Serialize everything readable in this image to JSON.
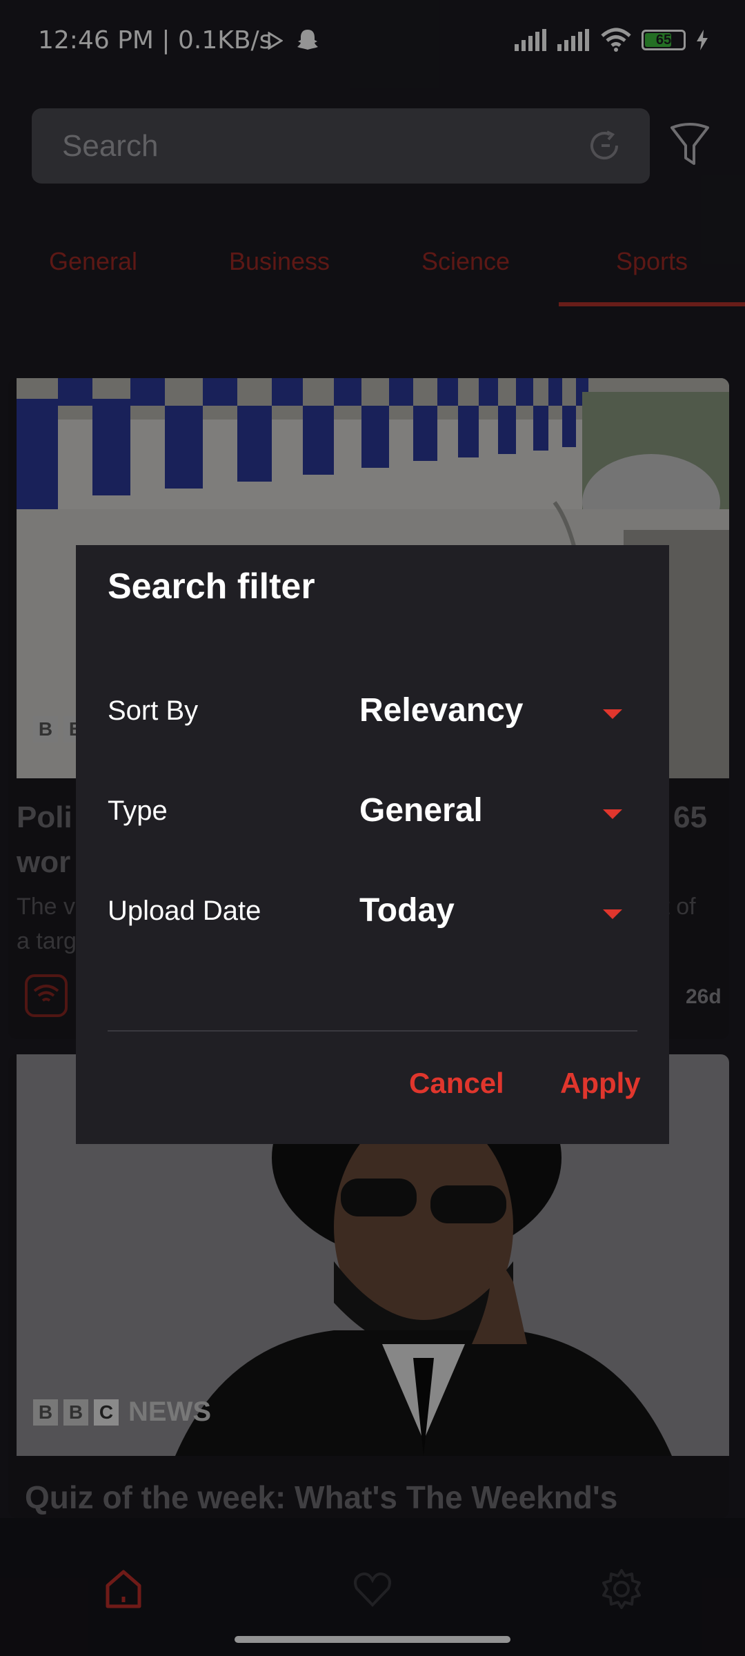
{
  "status": {
    "time": "12:46 PM | 0.1KB/s",
    "battery": "65"
  },
  "search": {
    "placeholder": "Search"
  },
  "tabs": [
    {
      "label": "General"
    },
    {
      "label": "Business"
    },
    {
      "label": "Science"
    },
    {
      "label": "Sports"
    }
  ],
  "cards": [
    {
      "title_start": "Poli",
      "title_end": "65",
      "title_line2": "wor",
      "desc_start": "The v",
      "desc_end": "rt of",
      "desc_line2": "a targ",
      "age": "26d"
    },
    {
      "title": "Quiz of the week: What's The Weeknd's",
      "logo_text": "NEWS"
    }
  ],
  "dialog": {
    "title": "Search filter",
    "rows": [
      {
        "label": "Sort By",
        "value": "Relevancy"
      },
      {
        "label": "Type",
        "value": "General"
      },
      {
        "label": "Upload Date",
        "value": "Today"
      }
    ],
    "cancel": "Cancel",
    "apply": "Apply"
  },
  "colors": {
    "accent": "#e0362d",
    "dialog_bg": "#201f24",
    "background": "#1c1b21"
  }
}
